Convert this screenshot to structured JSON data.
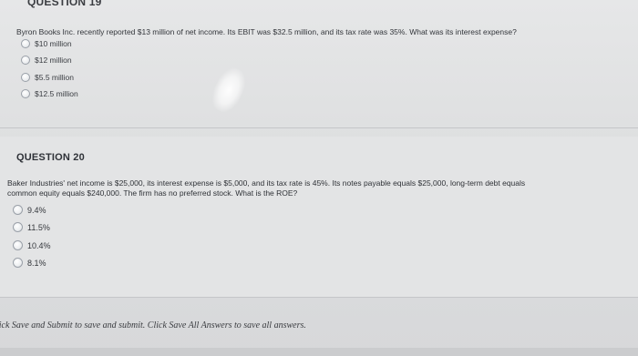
{
  "question19": {
    "header": "QUESTION 19",
    "text": "Byron Books Inc. recently reported $13 million of net income. Its EBIT was $32.5 million, and its tax rate was 35%. What was its interest expense?",
    "options": [
      "$10 million",
      "$12 million",
      "$5.5 million",
      "$12.5 million"
    ]
  },
  "question20": {
    "header": "QUESTION 20",
    "text_line1": "Baker Industries' net income is $25,000, its interest expense is $5,000, and its tax rate is 45%. Its notes payable equals $25,000, long-term debt equals",
    "text_line2": "common equity equals $240,000. The firm has no preferred stock. What is the ROE?",
    "options": [
      "9.4%",
      "11.5%",
      "10.4%",
      "8.1%"
    ]
  },
  "footer": {
    "text": "lick Save and Submit to save and submit. Click Save All Answers to save all answers."
  }
}
